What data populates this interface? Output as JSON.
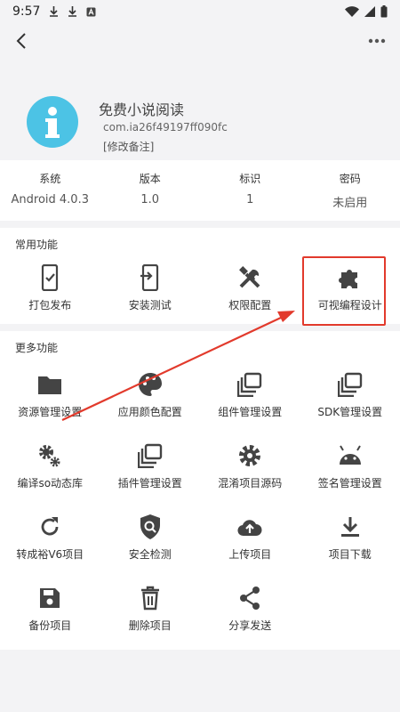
{
  "status_bar": {
    "time": "9:57"
  },
  "app": {
    "name": "免费小说阅读",
    "package": "com.ia26f49197ff090fc",
    "remark_link": "[修改备注]"
  },
  "info": [
    {
      "label": "系统",
      "value": "Android 4.0.3"
    },
    {
      "label": "版本",
      "value": "1.0"
    },
    {
      "label": "标识",
      "value": "1"
    },
    {
      "label": "密码",
      "value": "未启用"
    }
  ],
  "common": {
    "title": "常用功能",
    "items": [
      {
        "label": "打包发布",
        "icon": "phone-check-icon"
      },
      {
        "label": "安装测试",
        "icon": "install-icon"
      },
      {
        "label": "权限配置",
        "icon": "tools-icon"
      },
      {
        "label": "可视编程设计",
        "icon": "puzzle-icon"
      }
    ]
  },
  "more": {
    "title": "更多功能",
    "items": [
      {
        "label": "资源管理设置",
        "icon": "folder-icon"
      },
      {
        "label": "应用颜色配置",
        "icon": "palette-icon"
      },
      {
        "label": "组件管理设置",
        "icon": "layers-icon"
      },
      {
        "label": "SDK管理设置",
        "icon": "layers-icon"
      },
      {
        "label": "编译so动态库",
        "icon": "gears-icon"
      },
      {
        "label": "插件管理设置",
        "icon": "layers-icon"
      },
      {
        "label": "混淆项目源码",
        "icon": "gear-icon"
      },
      {
        "label": "签名管理设置",
        "icon": "android-icon"
      },
      {
        "label": "转成裕V6项目",
        "icon": "refresh-icon"
      },
      {
        "label": "安全检测",
        "icon": "shield-icon"
      },
      {
        "label": "上传项目",
        "icon": "cloud-upload-icon"
      },
      {
        "label": "项目下载",
        "icon": "download-icon"
      },
      {
        "label": "备份项目",
        "icon": "save-icon"
      },
      {
        "label": "删除项目",
        "icon": "trash-icon"
      },
      {
        "label": "分享发送",
        "icon": "share-icon"
      }
    ]
  },
  "colors": {
    "accent_logo": "#4cc3e5",
    "highlight": "#e23a2c",
    "icon": "#444444"
  }
}
